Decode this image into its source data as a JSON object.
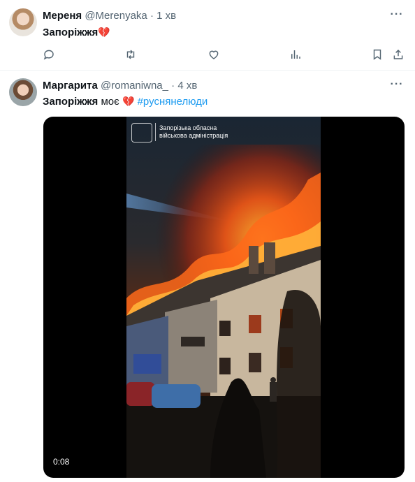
{
  "tweets": [
    {
      "name": "Мереня",
      "handle": "@Merenyaka",
      "dot": "·",
      "time": "1 хв",
      "text_bold": "Запоріжжя",
      "emoji": "💔",
      "more": "···"
    },
    {
      "name": "Маргарита",
      "handle": "@romaniwna_",
      "dot": "·",
      "time": "4 хв",
      "text_bold": "Запоріжжя",
      "text_plain": " моє ",
      "emoji": "💔",
      "hashtag": "#руснянелюди",
      "more": "···",
      "video": {
        "watermark_line1": "Запорізька обласна",
        "watermark_line2": "військова адміністрація",
        "timestamp": "0:08"
      }
    }
  ],
  "icons": [
    "reply-icon",
    "retweet-icon",
    "like-icon",
    "views-icon",
    "bookmark-icon",
    "share-icon"
  ],
  "colors": {
    "link": "#1d9bf0",
    "muted": "#536471",
    "heart": "#e0245e"
  }
}
